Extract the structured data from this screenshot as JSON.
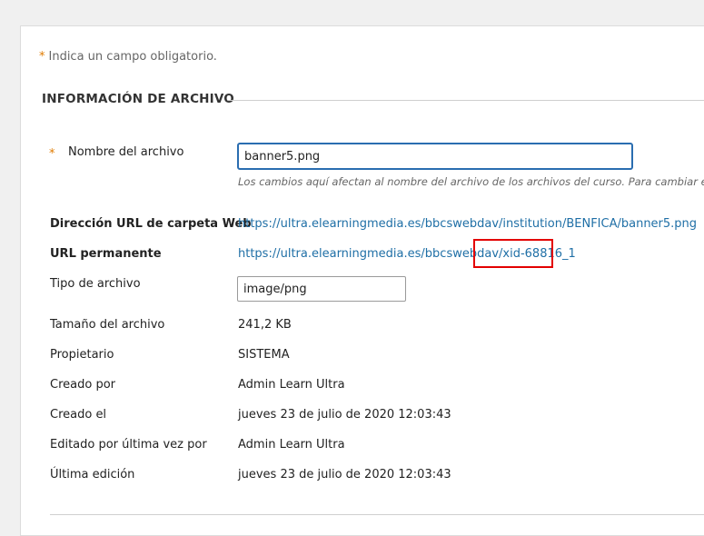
{
  "form": {
    "required_note_star": "*",
    "required_note": "Indica un campo obligatorio.",
    "section_title": "INFORMACIÓN DE ARCHIVO",
    "filename": {
      "required_star": "*",
      "label": "Nombre del archivo",
      "value": "banner5.png",
      "help": "Los cambios aquí afectan al nombre del archivo de los archivos del curso. Para cambiar el t"
    },
    "web_folder_url": {
      "label": "Dirección URL de carpeta Web",
      "value": "https://ultra.elearningmedia.es/bbcswebdav/institution/BENFICA/banner5.png"
    },
    "permanent_url": {
      "label": "URL permanente",
      "value_prefix": "https://ultra.elearningmedia.es/bbcswebdav/",
      "value_suffix": "xid-68816_1"
    },
    "file_type": {
      "label": "Tipo de archivo",
      "value": "image/png"
    },
    "file_size": {
      "label": "Tamaño del archivo",
      "value": "241,2 KB"
    },
    "owner": {
      "label": "Propietario",
      "value": "SISTEMA"
    },
    "created_by": {
      "label": "Creado por",
      "value": "Admin Learn Ultra"
    },
    "created_on": {
      "label": "Creado el",
      "value": "jueves 23 de julio de 2020 12:03:43"
    },
    "last_edited_by": {
      "label": "Editado por última vez por",
      "value": "Admin Learn Ultra"
    },
    "last_edited": {
      "label": "Última edición",
      "value": "jueves 23 de julio de 2020 12:03:43"
    }
  },
  "colors": {
    "link": "#1f6fa6",
    "required_star": "#e07b00",
    "focus_border": "#2a6db0",
    "highlight_box": "#e30000"
  }
}
